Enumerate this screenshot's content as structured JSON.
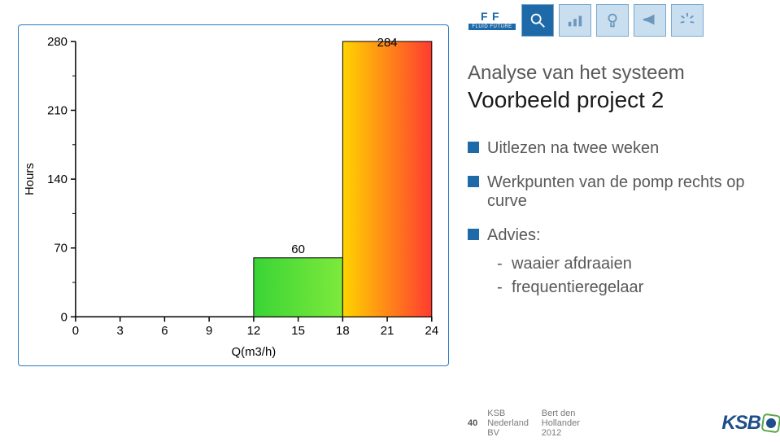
{
  "icons": {
    "ff_label": "FLUID FUTURE"
  },
  "header": {
    "line1": "Analyse van het systeem",
    "line2": "Voorbeeld project 2"
  },
  "bullets": [
    "Uitlezen na twee weken",
    "Werkpunten van de pomp rechts op curve",
    "Advies:"
  ],
  "sub_bullets": [
    "waaier afdraaien",
    "frequentieregelaar"
  ],
  "footer": {
    "page": "40",
    "org": "KSB Nederland BV",
    "author_year": "Bert den Hollander 2012",
    "logo_text": "KSB"
  },
  "chart_data": {
    "type": "bar",
    "xlabel": "Q(m3/h)",
    "ylabel": "Hours",
    "title": "",
    "xlim": [
      0,
      24
    ],
    "ylim": [
      0,
      280
    ],
    "x_ticks": [
      0,
      3,
      6,
      9,
      12,
      15,
      18,
      21,
      24
    ],
    "y_ticks": [
      0,
      70,
      140,
      210,
      280
    ],
    "bars": [
      {
        "x_start": 12,
        "x_end": 18,
        "value": 60,
        "label": "60",
        "fill_left": "#39d436",
        "fill_right": "#7eea3c"
      },
      {
        "x_start": 18,
        "x_end": 24,
        "value": 284,
        "label": "284",
        "fill_left": "#ffd400",
        "fill_right": "#ff3b30"
      }
    ]
  }
}
